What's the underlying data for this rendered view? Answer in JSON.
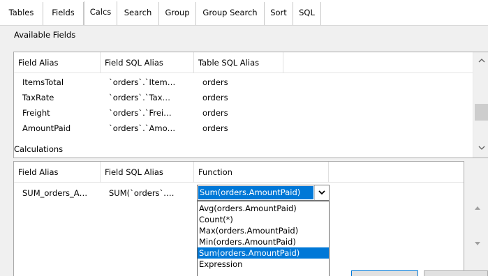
{
  "tabs": [
    "Tables",
    "Fields",
    "Calcs",
    "Search",
    "Group",
    "Group Search",
    "Sort",
    "SQL"
  ],
  "active_tab": "Calcs",
  "available_fields": {
    "label": "Available Fields",
    "columns": [
      "Field Alias",
      "Field SQL Alias",
      "Table SQL Alias"
    ],
    "rows": [
      [
        "ItemsTotal",
        "`orders`.`Item…",
        "orders"
      ],
      [
        "TaxRate",
        "`orders`.`Tax…",
        "orders"
      ],
      [
        "Freight",
        "`orders`.`Frei…",
        "orders"
      ],
      [
        "AmountPaid",
        "`orders`.`Amo…",
        "orders"
      ]
    ]
  },
  "calculations": {
    "label": "Calculations",
    "columns": [
      "Field Alias",
      "Field SQL Alias",
      "Function"
    ],
    "rows": [
      [
        "SUM_orders_A…",
        "SUM(`orders`.…",
        "Sum(orders.AmountPaid)"
      ]
    ]
  },
  "function_dropdown": {
    "selected": "Sum(orders.AmountPaid)",
    "options": [
      "Avg(orders.AmountPaid)",
      "Count(*)",
      "Max(orders.AmountPaid)",
      "Min(orders.AmountPaid)",
      "Sum(orders.AmountPaid)",
      "Expression"
    ]
  },
  "icons": {
    "scroll_up": "chevron-up-icon",
    "scroll_down": "chevron-down-icon",
    "combo_arrow": "chevron-down-icon",
    "move_up": "triangle-up-icon",
    "move_down": "triangle-down-icon"
  },
  "colors": {
    "selection": "#0078d7",
    "panel": "#f0f0f0",
    "grid_border": "#aaaaaa"
  }
}
